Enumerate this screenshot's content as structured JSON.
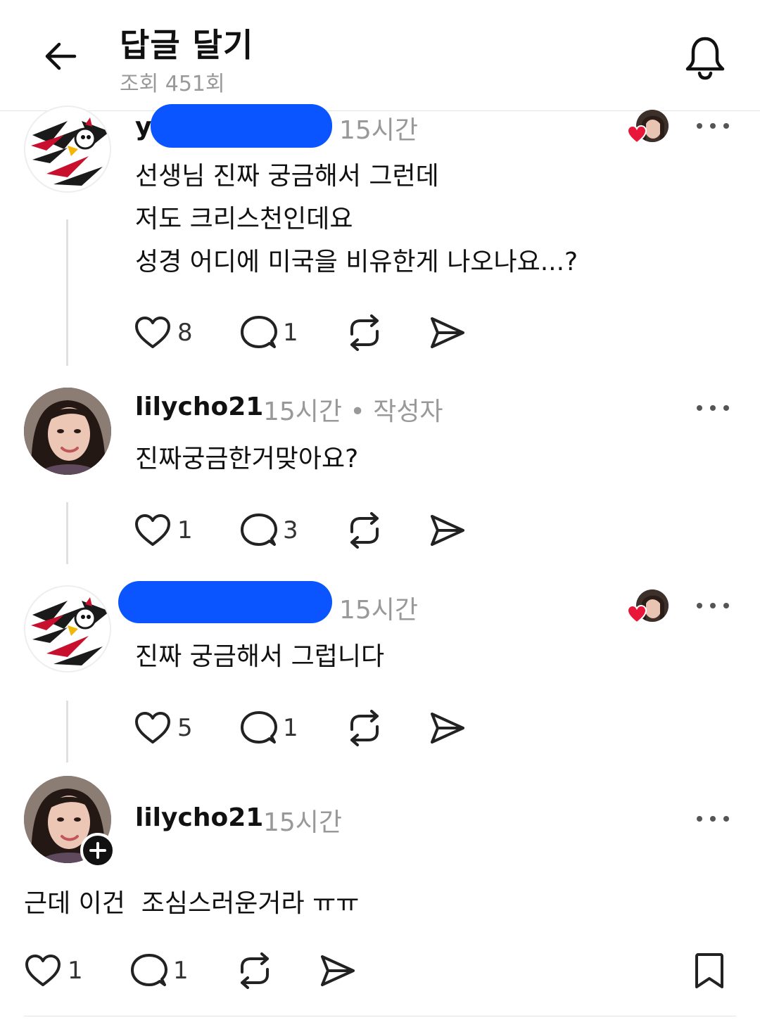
{
  "header": {
    "title": "답글 달기",
    "views": "조회 451회"
  },
  "posts": [
    {
      "username_visible": "y",
      "time": "15시간",
      "lines": "선생님 진짜 궁금해서 그런데\n저도 크리스천인데요\n성경 어디에 미국을 비유한게 나오나요...?",
      "likes": "8",
      "replies": "1"
    },
    {
      "username": "lilycho21",
      "time": "15시간",
      "author_tag": "• 작성자",
      "lines": "진짜궁금한거맞아요?",
      "likes": "1",
      "replies": "3"
    },
    {
      "time": "15시간",
      "lines": "진짜 궁금해서 그럽니다",
      "likes": "5",
      "replies": "1"
    },
    {
      "username": "lilycho21",
      "time": "15시간",
      "lines": "근데 이건  조심스러운거라 ㅠㅠ",
      "likes": "1",
      "replies": "1"
    }
  ],
  "colors": {
    "redaction": "#0a55ff",
    "liked_heart": "#e8173a",
    "muted_text": "#999999"
  },
  "icons": [
    "back-arrow-icon",
    "bell-icon",
    "heart-icon",
    "comment-icon",
    "repost-icon",
    "share-icon",
    "more-icon",
    "bookmark-icon",
    "plus-icon"
  ]
}
